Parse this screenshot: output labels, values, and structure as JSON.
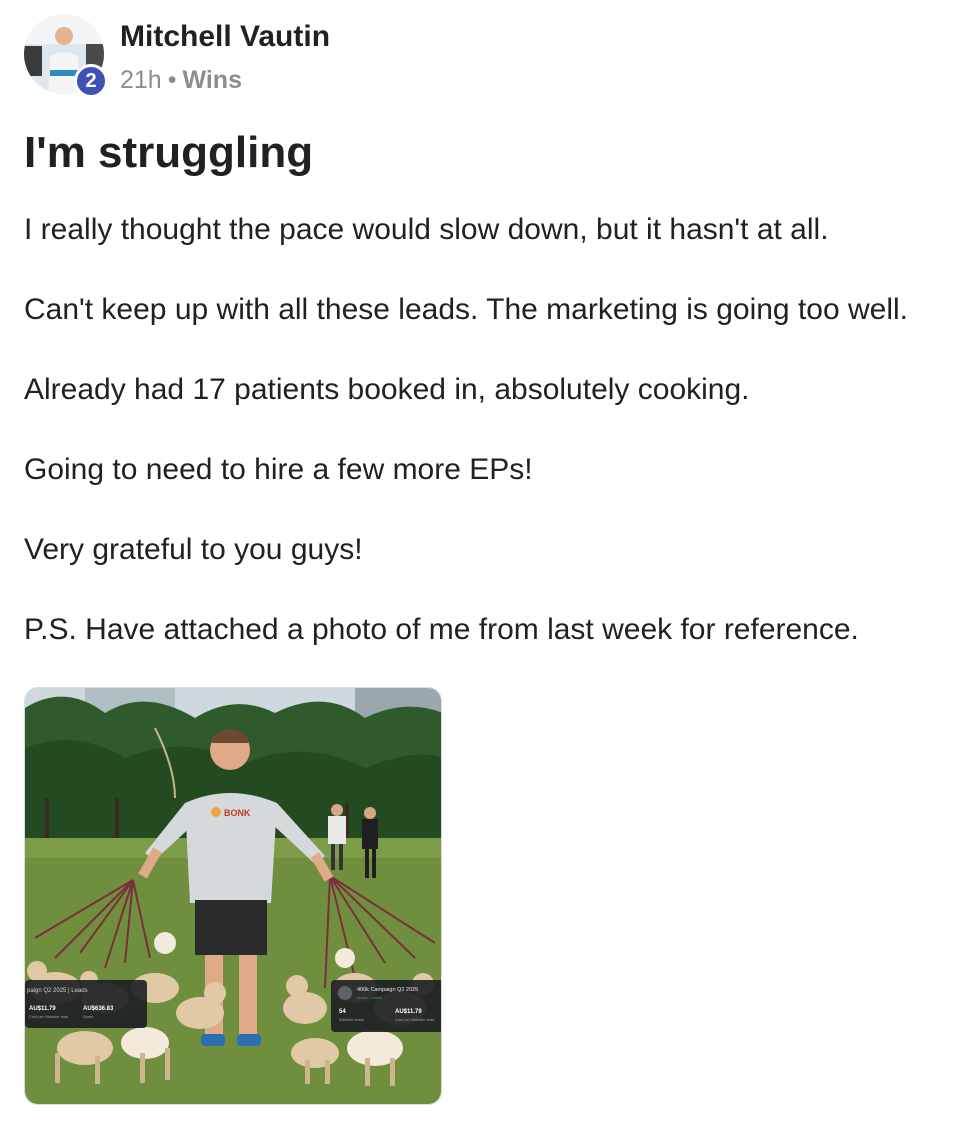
{
  "post": {
    "author": "Mitchell Vautin",
    "level": "2",
    "time_ago": "21h",
    "separator": "•",
    "category": "Wins",
    "title": "I'm struggling",
    "paragraphs": [
      "I really thought the pace would slow down, but it hasn't at all.",
      "Can't keep up with all these leads. The marketing is going too well.",
      "Already had 17 patients booked in, absolutely cooking.",
      "Going to need to hire a few more EPs!",
      "Very grateful to you guys!",
      "P.S. Have attached a photo of me from last week for reference."
    ]
  },
  "attachment": {
    "shirt_logo": "BONK",
    "left_card": {
      "title": "paign Q2 2025 | Leads",
      "stat1_value": "AU$11.79",
      "stat1_label": "Cost per Website lead",
      "stat2_value": "AU$636.83",
      "stat2_label": "Spent"
    },
    "right_card": {
      "title": "400k Campaign Q2 2025",
      "subtitle": "Active • Leads",
      "stat1_value": "54",
      "stat1_label": "Website leads",
      "stat2_value": "AU$11.79",
      "stat2_label": "Cost per Website lead"
    }
  },
  "colors": {
    "badge": "#3f51b5",
    "meta_text": "#8a8d91",
    "grass": "#6f8f3e",
    "trees": "#2f5a2c"
  }
}
